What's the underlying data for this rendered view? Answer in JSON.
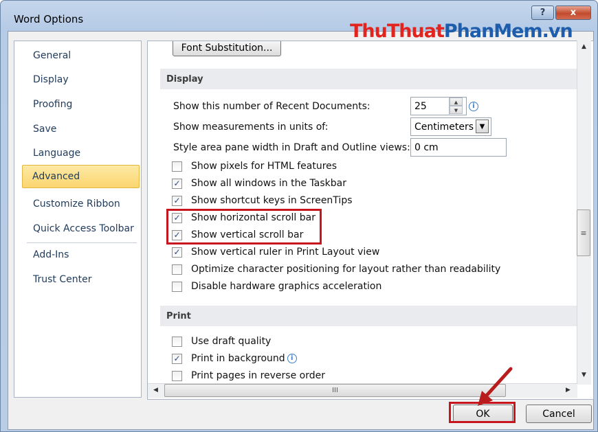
{
  "window": {
    "title": "Word Options",
    "help_glyph": "?",
    "close_glyph": "x"
  },
  "watermark": {
    "part1": "ThuThuat",
    "part2": "PhanMem",
    "part3": ".vn"
  },
  "sidebar": {
    "items": [
      {
        "label": "General"
      },
      {
        "label": "Display"
      },
      {
        "label": "Proofing"
      },
      {
        "label": "Save"
      },
      {
        "label": "Language"
      },
      {
        "label": "Advanced"
      },
      {
        "label": "Customize Ribbon"
      },
      {
        "label": "Quick Access Toolbar"
      },
      {
        "label": "Add-Ins"
      },
      {
        "label": "Trust Center"
      }
    ],
    "active": "Advanced"
  },
  "content": {
    "font_substitution_button": "Font Substitution...",
    "display_section": {
      "heading": "Display",
      "recent_docs_label": "Show this number of Recent Documents:",
      "recent_docs_value": "25",
      "units_label": "Show measurements in units of:",
      "units_value": "Centimeters",
      "style_area_label": "Style area pane width in Draft and Outline views:",
      "style_area_value": "0 cm",
      "options": [
        {
          "label": "Show pixels for HTML features",
          "checked": false
        },
        {
          "label": "Show all windows in the Taskbar",
          "checked": true
        },
        {
          "label": "Show shortcut keys in ScreenTips",
          "checked": true
        },
        {
          "label": "Show horizontal scroll bar",
          "checked": true
        },
        {
          "label": "Show vertical scroll bar",
          "checked": true
        },
        {
          "label": "Show vertical ruler in Print Layout view",
          "checked": true
        },
        {
          "label": "Optimize character positioning for layout rather than readability",
          "checked": false
        },
        {
          "label": "Disable hardware graphics acceleration",
          "checked": false
        }
      ]
    },
    "print_section": {
      "heading": "Print",
      "options": [
        {
          "label": "Use draft quality",
          "checked": false
        },
        {
          "label": "Print in background",
          "checked": true
        },
        {
          "label": "Print pages in reverse order",
          "checked": false
        }
      ]
    }
  },
  "scrollbars": {
    "vertical_grip": "≡",
    "horizontal_grip": "III",
    "up": "▲",
    "down": "▼",
    "left": "◀",
    "right": "▶"
  },
  "footer": {
    "ok_label": "OK",
    "cancel_label": "Cancel"
  },
  "colors": {
    "highlight": "#c8141c",
    "accent": "#fbd66f",
    "watermark_red": "#e1241d",
    "watermark_blue": "#1d5dab"
  }
}
